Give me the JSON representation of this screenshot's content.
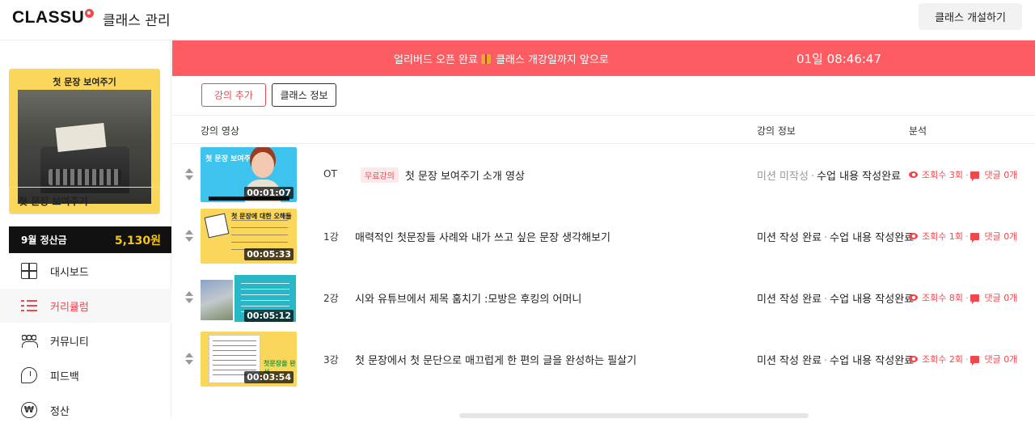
{
  "header": {
    "logo": "CLASSU",
    "page_title": "클래스 관리",
    "open_class_button": "클래스 개설하기"
  },
  "sidebar": {
    "thumbnail_title": "첫 문장 보여주기",
    "class_select_value": "첫 문장 보여주기",
    "settlement": {
      "label": "9월 정산금",
      "amount": "5,130원"
    },
    "nav": [
      {
        "label": "대시보드",
        "icon": "dashboard-icon",
        "active": false
      },
      {
        "label": "커리큘럼",
        "icon": "curriculum-list-icon",
        "active": true
      },
      {
        "label": "커뮤니티",
        "icon": "community-icon",
        "active": false
      },
      {
        "label": "피드백",
        "icon": "feedback-icon",
        "active": false
      },
      {
        "label": "정산",
        "icon": "won-icon",
        "active": false
      }
    ]
  },
  "banner": {
    "text_before": "얼리버드 오픈 완료",
    "text_after": "클래스 개강일까지 앞으로",
    "timer": "01일 08:46:47",
    "color": "#fd5c63"
  },
  "actions": {
    "add_lecture": "강의 추가",
    "class_info": "클래스 정보"
  },
  "table": {
    "headers": {
      "video": "강의 영상",
      "info": "강의 정보",
      "analysis": "분석"
    },
    "rows": [
      {
        "episode": "OT",
        "badge": "무료강의",
        "title": "첫 문장 보여주기 소개 영상",
        "duration": "00:01:07",
        "thumb_title": "첫 문장 보여주기",
        "mission": "미션 미작성",
        "content": "수업 내용 작성완료",
        "views": "조회수 3회",
        "comments": "댓글 0개"
      },
      {
        "episode": "1강",
        "badge": "",
        "title": "매력적인 첫문장들 사례와 내가 쓰고 싶은 문장 생각해보기",
        "duration": "00:05:33",
        "thumb_title": "첫 문장에 대한 오해들",
        "mission": "미션 작성 완료",
        "content": "수업 내용 작성완료",
        "views": "조회수 1회",
        "comments": "댓글 0개"
      },
      {
        "episode": "2강",
        "badge": "",
        "title": "시와 유튜브에서 제목 훔치기 :모방은 후킹의 어머니",
        "duration": "00:05:12",
        "thumb_title": "",
        "mission": "미션 작성 완료",
        "content": "수업 내용 작성완료",
        "views": "조회수 8회",
        "comments": "댓글 0개"
      },
      {
        "episode": "3강",
        "badge": "",
        "title": "첫 문장에서 첫 문단으로 매끄럽게 한 편의 글을 완성하는 필살기",
        "duration": "00:03:54",
        "thumb_title": "첫문장을 완성",
        "mission": "미션 작성 완료",
        "content": "수업 내용 작성완료",
        "views": "조회수 2회",
        "comments": "댓글 0개"
      }
    ]
  },
  "colors": {
    "accent": "#f0484f",
    "settlement_amount": "#f5c518"
  }
}
